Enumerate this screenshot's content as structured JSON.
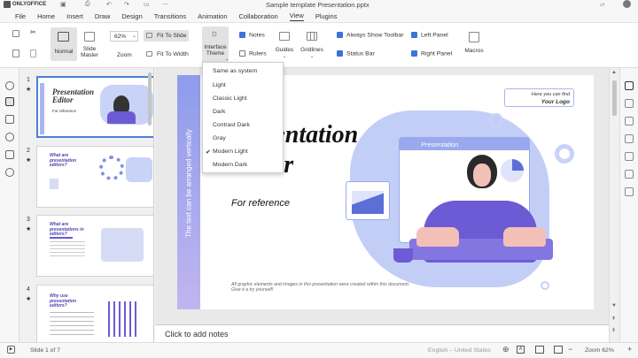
{
  "app": {
    "logo_text": "ONLYOFFICE",
    "window_title": "Sample template Presentation.pptx"
  },
  "menu": [
    "File",
    "Home",
    "Insert",
    "Draw",
    "Design",
    "Transitions",
    "Animation",
    "Collaboration",
    "View",
    "Plugins"
  ],
  "ribbon": {
    "normal": "Normal",
    "slide_master": "Slide Master",
    "zoom_value": "62%",
    "zoom": "Zoom",
    "fit_to_slide": "Fit To Slide",
    "fit_to_width": "Fit To Width",
    "interface_theme": "Interface Theme",
    "notes": "Notes",
    "rulers": "Rulers",
    "guides": "Guides",
    "gridlines": "Gridlines",
    "always_show_toolbar": "Always Show Toolbar",
    "status_bar": "Status Bar",
    "left_panel": "Left Panel",
    "right_panel": "Right Panel",
    "macros": "Macros"
  },
  "theme_menu": {
    "items": [
      "Same as system",
      "Light",
      "Classic Light",
      "Dark",
      "Contrast Dark",
      "Gray",
      "Modern Light",
      "Modern Dark"
    ],
    "selected": "Modern Light"
  },
  "thumbnails": {
    "numbers": [
      "1",
      "2",
      "3",
      "4"
    ],
    "t1_title": "Presentation Editor",
    "t1_sub": "For reference",
    "t2_title": "What are presentation editors?",
    "t3_title": "What are presentations in editors?",
    "t4_title": "Why use presentation editors?"
  },
  "slide": {
    "vertical_text": "The text can be arranged vertically",
    "title_line1": "Presentation",
    "title_line2": "Editor",
    "subtitle": "For reference",
    "logo_line1": "Here you can find",
    "logo_line2": "Your Logo",
    "window_label": "Presentation",
    "footer_line1": "All graphic elements and images in this presentation were created within this document.",
    "footer_line2": "Give it a try yourself!"
  },
  "notes_placeholder": "Click to add notes",
  "status": {
    "slide": "Slide 1 of 7",
    "language": "English – United States",
    "zoom": "Zoom 62%"
  },
  "colors": {
    "accent": "#3d72d9",
    "purple": "#6c5bd4",
    "blob": "#b9c6f5"
  }
}
